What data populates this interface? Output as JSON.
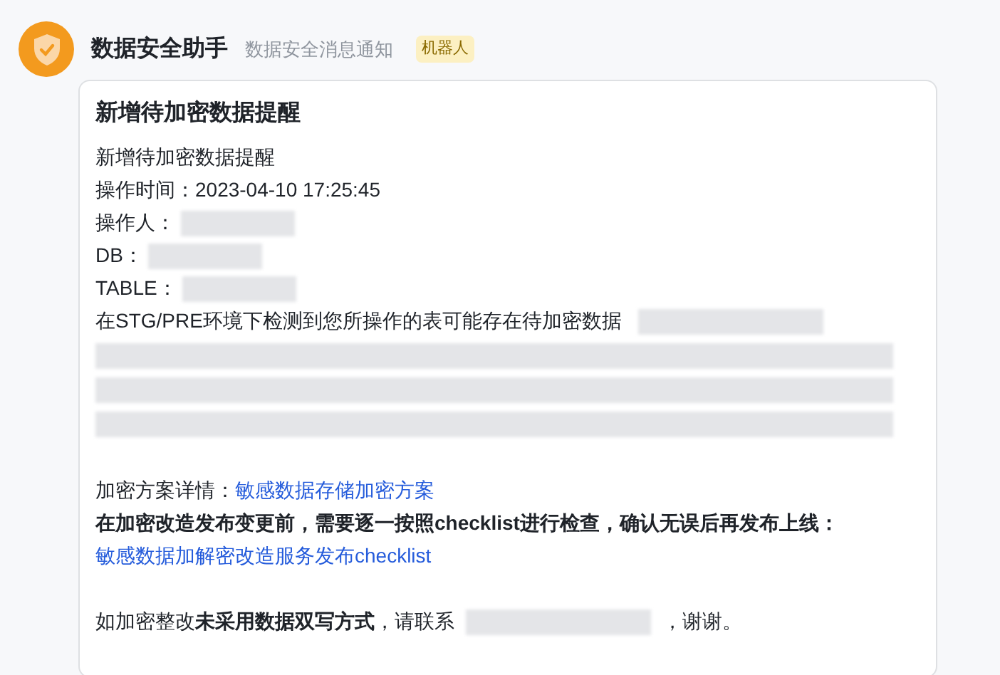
{
  "header": {
    "name": "数据安全助手",
    "subtitle": "数据安全消息通知",
    "badge": "机器人"
  },
  "message": {
    "title": "新增待加密数据提醒",
    "lines": [
      {
        "text": "新增待加密数据提醒",
        "redacted": false
      },
      {
        "text": "操作时间：2023-04-10 17:25:45",
        "redacted": false
      },
      {
        "text": "操作人：",
        "redacted": true
      },
      {
        "text": "DB：",
        "redacted": true
      },
      {
        "text": "TABLE：",
        "redacted": true
      },
      {
        "text": "在STG/PRE环境下检测到您所操作的表可能存在待加密数据",
        "redacted": true
      }
    ],
    "details_label": "加密方案详情：",
    "details_link": "敏感数据存储加密方案",
    "checklist_text": "在加密改造发布变更前，需要逐一按照checklist进行检查，确认无误后再发布上线：",
    "checklist_link": "敏感数据加解密改造服务发布checklist",
    "contact_text": "如加密整改**未采用数据双写方式**，请联系",
    "contact_end": "，谢谢。"
  }
}
